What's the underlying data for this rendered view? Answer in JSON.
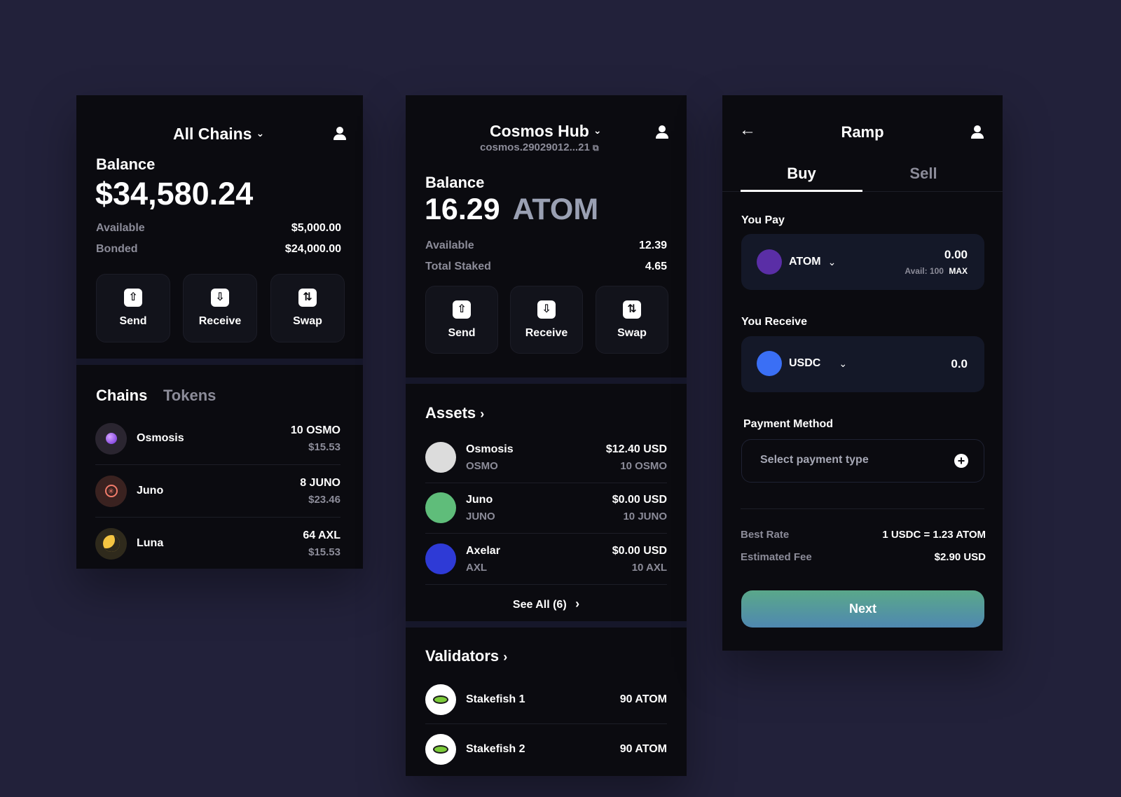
{
  "wallet": {
    "header_title": "All Chains",
    "balance_label": "Balance",
    "balance_value": "$34,580.24",
    "available_label": "Available",
    "available_value": "$5,000.00",
    "bonded_label": "Bonded",
    "bonded_value": "$24,000.00",
    "actions": [
      "Send",
      "Receive",
      "Swap"
    ],
    "tabs": [
      "Chains",
      "Tokens"
    ],
    "chains": [
      {
        "name": "Osmosis",
        "amount": "10 OSMO",
        "usd": "$15.53"
      },
      {
        "name": "Juno",
        "amount": "8 JUNO",
        "usd": "$23.46"
      },
      {
        "name": "Luna",
        "amount": "64 AXL",
        "usd": "$15.53"
      }
    ]
  },
  "hub": {
    "header_title": "Cosmos Hub",
    "address": "cosmos.29029012...21",
    "balance_label": "Balance",
    "balance_amount": "16.29",
    "balance_unit": "ATOM",
    "available_label": "Available",
    "available_value": "12.39",
    "staked_label": "Total Staked",
    "staked_value": "4.65",
    "actions": [
      "Send",
      "Receive",
      "Swap"
    ],
    "assets_title": "Assets",
    "assets": [
      {
        "name": "Osmosis",
        "symbol": "OSMO",
        "usd": "$12.40 USD",
        "amount": "10 OSMO",
        "color": "#dcdcdc"
      },
      {
        "name": "Juno",
        "symbol": "JUNO",
        "usd": "$0.00 USD",
        "amount": "10 JUNO",
        "color": "#5fbd7a"
      },
      {
        "name": "Axelar",
        "symbol": "AXL",
        "usd": "$0.00 USD",
        "amount": "10 AXL",
        "color": "#2e3ad6"
      }
    ],
    "see_all": "See All (6)",
    "validators_title": "Validators",
    "validators": [
      {
        "name": "Stakefish 1",
        "amount": "90 ATOM"
      },
      {
        "name": "Stakefish 2",
        "amount": "90 ATOM"
      }
    ]
  },
  "ramp": {
    "title": "Ramp",
    "tabs": [
      "Buy",
      "Sell"
    ],
    "pay_label": "You Pay",
    "pay_token": "ATOM",
    "pay_amount": "0.00",
    "pay_avail": "Avail: 100",
    "max_label": "MAX",
    "receive_label": "You Receive",
    "receive_token": "USDC",
    "receive_amount": "0.0",
    "payment_label": "Payment Method",
    "payment_placeholder": "Select payment type",
    "rate_label": "Best Rate",
    "rate_value": "1 USDC = 1.23 ATOM",
    "fee_label": "Estimated Fee",
    "fee_value": "$2.90 USD",
    "next_label": "Next"
  },
  "colors": {
    "background": "#22213a",
    "panel": "#0b0b10",
    "atom": "#5a2ea6",
    "usdc": "#3a6ff5"
  }
}
